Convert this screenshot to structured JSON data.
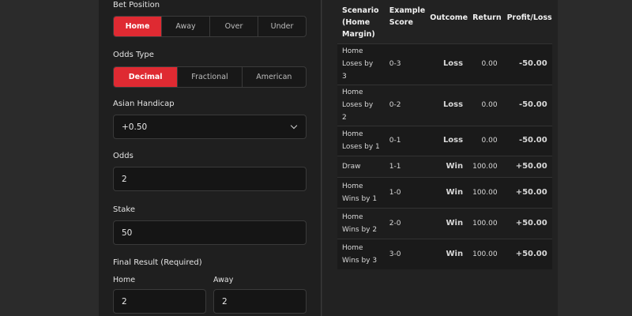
{
  "form": {
    "bet_position": {
      "label": "Bet Position",
      "options": [
        "Home",
        "Away",
        "Over",
        "Under"
      ],
      "selected": "Home"
    },
    "odds_type": {
      "label": "Odds Type",
      "options": [
        "Decimal",
        "Fractional",
        "American"
      ],
      "selected": "Decimal"
    },
    "asian_handicap": {
      "label": "Asian Handicap",
      "value": "+0.50"
    },
    "odds": {
      "label": "Odds",
      "value": "2"
    },
    "stake": {
      "label": "Stake",
      "value": "50"
    },
    "final_result": {
      "label": "Final Result (Required)",
      "home_label": "Home",
      "home_value": "2",
      "away_label": "Away",
      "away_value": "2"
    }
  },
  "table": {
    "headers": {
      "scenario": [
        "Scenario",
        "(Home",
        "Margin)"
      ],
      "score": [
        "Example",
        "Score"
      ],
      "outcome": "Outcome",
      "return": "Return",
      "profit": "Profit/Loss"
    },
    "rows": [
      {
        "scenario": [
          "Home",
          "Loses by",
          "3"
        ],
        "score": "0-3",
        "outcome": "Loss",
        "return": "0.00",
        "profit": "-50.00"
      },
      {
        "scenario": [
          "Home",
          "Loses by",
          "2"
        ],
        "score": "0-2",
        "outcome": "Loss",
        "return": "0.00",
        "profit": "-50.00"
      },
      {
        "scenario": [
          "Home",
          "Loses by 1"
        ],
        "score": "0-1",
        "outcome": "Loss",
        "return": "0.00",
        "profit": "-50.00"
      },
      {
        "scenario": [
          "Draw"
        ],
        "score": "1-1",
        "outcome": "Win",
        "return": "100.00",
        "profit": "+50.00"
      },
      {
        "scenario": [
          "Home",
          "Wins by 1"
        ],
        "score": "1-0",
        "outcome": "Win",
        "return": "100.00",
        "profit": "+50.00"
      },
      {
        "scenario": [
          "Home",
          "Wins by 2"
        ],
        "score": "2-0",
        "outcome": "Win",
        "return": "100.00",
        "profit": "+50.00"
      },
      {
        "scenario": [
          "Home",
          "Wins by 3"
        ],
        "score": "3-0",
        "outcome": "Win",
        "return": "100.00",
        "profit": "+50.00"
      }
    ]
  },
  "colors": {
    "accent": "#df2a32",
    "win": "#4ccb4c",
    "loss": "#e23838"
  }
}
